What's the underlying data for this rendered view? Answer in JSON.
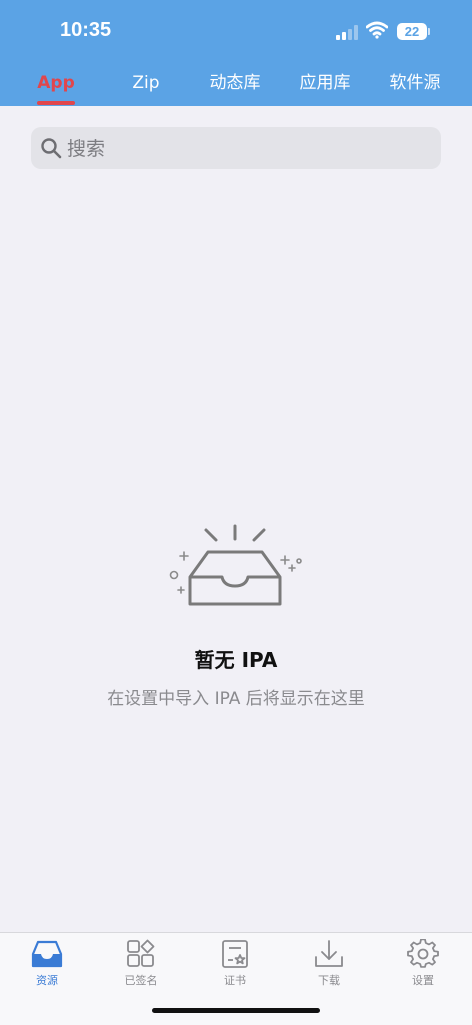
{
  "status_bar": {
    "time": "10:35",
    "battery": "22"
  },
  "tabs": [
    {
      "label": "App",
      "active": true
    },
    {
      "label": "Zip",
      "active": false
    },
    {
      "label": "动态库",
      "active": false
    },
    {
      "label": "应用库",
      "active": false
    },
    {
      "label": "软件源",
      "active": false
    }
  ],
  "search": {
    "placeholder": "搜索",
    "value": ""
  },
  "empty_state": {
    "icon": "empty-box-icon",
    "title": "暂无 IPA",
    "subtitle": "在设置中导入 IPA 后将显示在这里"
  },
  "bottom_tabs": [
    {
      "label": "资源",
      "icon": "inbox-tray-icon",
      "active": true
    },
    {
      "label": "已签名",
      "icon": "apps-grid-icon",
      "active": false
    },
    {
      "label": "证书",
      "icon": "certificate-icon",
      "active": false
    },
    {
      "label": "下载",
      "icon": "download-icon",
      "active": false
    },
    {
      "label": "设置",
      "icon": "gear-icon",
      "active": false
    }
  ],
  "colors": {
    "header": "#5ba3e5",
    "active_tab": "#e0464c",
    "active_bottom_tab": "#3a7bd5",
    "background": "#f1f0f6"
  }
}
